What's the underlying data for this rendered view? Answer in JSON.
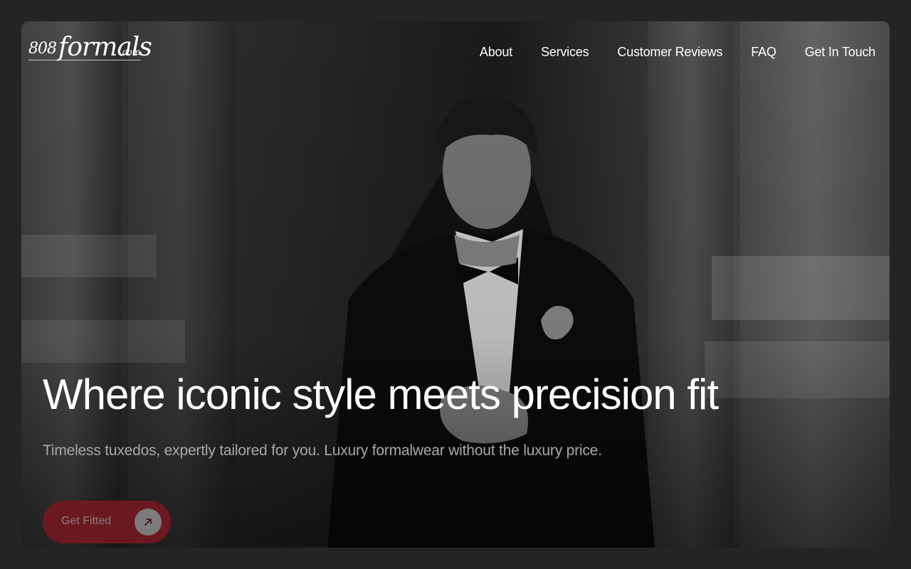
{
  "brand": {
    "logo_number": "808",
    "logo_word": "formals",
    "logo_domain": ".com"
  },
  "nav": {
    "items": [
      {
        "label": "About"
      },
      {
        "label": "Services"
      },
      {
        "label": "Customer Reviews"
      },
      {
        "label": "FAQ"
      },
      {
        "label": "Get In Touch"
      }
    ]
  },
  "hero": {
    "headline": "Where iconic style meets precision fit",
    "subheadline": "Timeless tuxedos, expertly tailored for you. Luxury formalwear without the luxury price.",
    "cta_label": "Get Fitted",
    "cta_icon": "arrow-up-right-icon"
  },
  "colors": {
    "page_background": "#252323",
    "cta_background": "#6b1921",
    "text_primary": "#ffffff",
    "text_muted": "#a9a8a8"
  }
}
